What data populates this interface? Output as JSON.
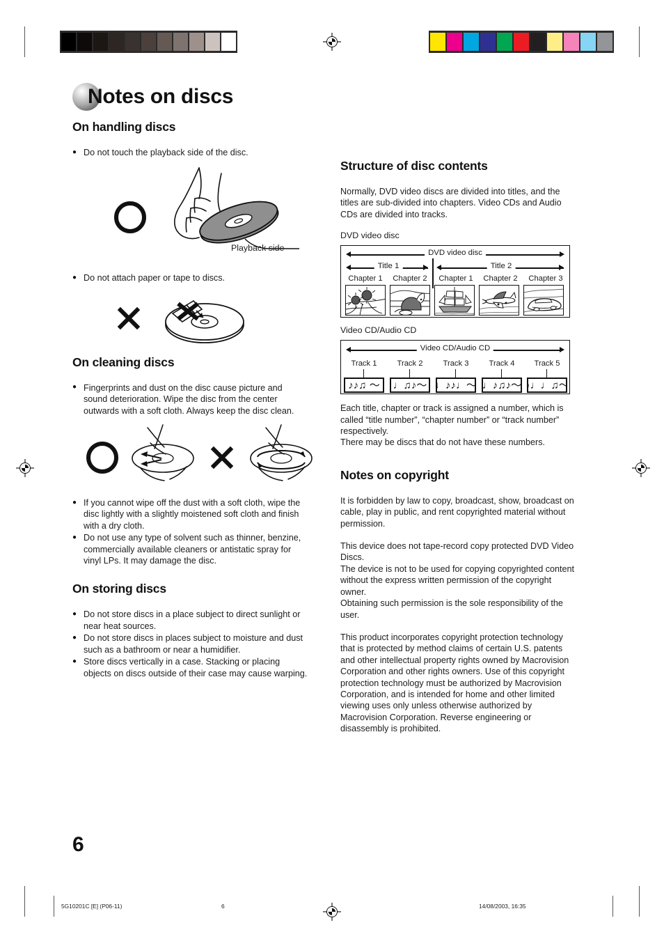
{
  "document": {
    "title": "Notes on discs",
    "page_number": "6"
  },
  "printer_marks": {
    "grayscale_swatches": [
      "#000000",
      "#0d0a09",
      "#1c1713",
      "#2d2622",
      "#3a3230",
      "#4b403c",
      "#655954",
      "#7e736e",
      "#9e918c",
      "#cdc3be",
      "#ffffff"
    ],
    "color_swatches": [
      "#ffe600",
      "#ec008c",
      "#00a7e1",
      "#2e3192",
      "#00a651",
      "#ed1c24",
      "#231f20",
      "#fdee87",
      "#f584bb",
      "#86d5f4",
      "#939598"
    ],
    "registration_icon": "registration-crosshair-icon"
  },
  "left_column": {
    "handling": {
      "heading": "On handling discs",
      "bullets": [
        "Do not touch the playback side of the disc.",
        "Do not attach paper or tape to discs."
      ],
      "figure1": {
        "ok_icon": "ok-circle-icon",
        "illustration": "hand-holding-disc-by-edges-illustration",
        "callout": "Playback side"
      },
      "figure2": {
        "x_icon": "x-cross-icon",
        "illustration": "disc-with-tape-attached-illustration"
      }
    },
    "cleaning": {
      "heading": "On cleaning discs",
      "bullets": [
        "Fingerprints and dust on the disc cause picture and sound deterioration. Wipe the disc from the center outwards with a soft cloth. Always keep the disc clean.",
        "If you cannot wipe off the dust with a soft cloth, wipe the disc lightly with a slightly moistened soft cloth and finish with a dry cloth.",
        "Do not use any type of solvent such as thinner, benzine, commercially available cleaners or antistatic spray for vinyl LPs. It may damage the disc."
      ],
      "figure": {
        "ok_icon": "ok-circle-icon",
        "ok_illustration": "hand-wiping-disc-radially-illustration",
        "x_icon": "x-cross-icon",
        "x_illustration": "hand-wiping-disc-circularly-illustration"
      }
    },
    "storing": {
      "heading": "On storing discs",
      "bullets": [
        "Do not store discs in a place subject to direct sunlight or near heat sources.",
        "Do not store discs in places subject to moisture and dust such as a bathroom or near a humidifier.",
        "Store discs vertically in a case. Stacking or placing objects on discs outside of their case may cause warping."
      ]
    }
  },
  "right_column": {
    "structure": {
      "heading": "Structure of disc contents",
      "intro": "Normally, DVD video discs are divided into titles, and the titles are sub-divided into chapters. Video CDs and Audio CDs are divided into tracks.",
      "dvd_caption": "DVD video disc",
      "dvd_diagram": {
        "span_label": "DVD video disc",
        "titles": [
          {
            "label": "Title 1",
            "chapters": [
              "Chapter 1",
              "Chapter 2"
            ]
          },
          {
            "label": "Title 2",
            "chapters": [
              "Chapter 1",
              "Chapter 2",
              "Chapter 3"
            ]
          }
        ],
        "thumbnails": [
          "sunflower-illustration",
          "cat-illustration",
          "sailing-ship-illustration",
          "airplane-illustration",
          "car-illustration"
        ]
      },
      "cd_caption": "Video CD/Audio CD",
      "cd_diagram": {
        "span_label": "Video CD/Audio CD",
        "tracks": [
          "Track 1",
          "Track 2",
          "Track 3",
          "Track 4",
          "Track 5"
        ],
        "track_glyphs": [
          "♪♪♫  ～",
          "♩♫♪～",
          "♩♪♪♩～",
          "♩♪♫♪～",
          "♪♩♩♫～"
        ]
      },
      "note": "Each title, chapter or track is assigned a number, which is called “title number”, “chapter number” or “track number” respectively.",
      "note2": "There may be discs that do not have these numbers."
    },
    "copyright": {
      "heading": "Notes on copyright",
      "paragraphs": [
        "It is forbidden by law to copy, broadcast, show, broadcast on cable, play in public, and rent copyrighted material without permission.",
        "This device does not tape-record copy protected DVD Video Discs.\nThe device is not to be used for copying copyrighted content without the express written permission of the copyright owner.\nObtaining such permission is the sole responsibility of the user.",
        "This product incorporates copyright protection technology that is protected by method claims of certain U.S. patents and other intellectual property rights owned by Macrovision Corporation and other rights owners. Use of this copyright protection technology must be authorized by Macrovision Corporation, and is intended for home and other limited viewing uses only unless otherwise authorized by Macrovision Corporation. Reverse engineering or disassembly is prohibited."
      ]
    }
  },
  "footer": {
    "file_code": "5G10201C [E] (P06-11)",
    "page": "6",
    "timestamp": "14/08/2003, 16:35"
  }
}
